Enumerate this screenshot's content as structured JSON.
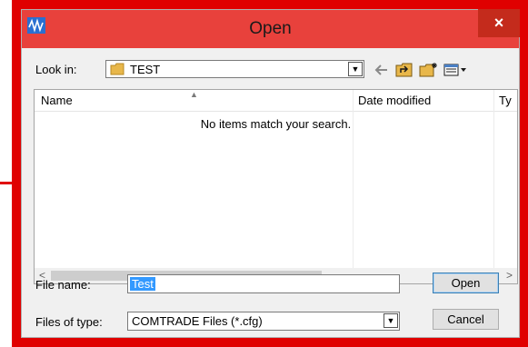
{
  "window": {
    "title": "Open",
    "close_glyph": "×",
    "accent": "#e00000",
    "title_bar_color": "#e8413c"
  },
  "lookin": {
    "label": "Look in:",
    "value": "TEST",
    "arrow": "▼"
  },
  "columns": {
    "name": "Name",
    "date_modified": "Date modified",
    "type": "Ty"
  },
  "list": {
    "empty_message": "No items match your search.",
    "scroll_left": "<",
    "scroll_right": ">"
  },
  "filename": {
    "label": "File name:",
    "value": "Test"
  },
  "filetype": {
    "label": "Files of type:",
    "value": "COMTRADE Files (*.cfg)",
    "arrow": "▼"
  },
  "buttons": {
    "open": "Open",
    "cancel": "Cancel"
  },
  "icons": [
    "app-waveform-icon",
    "folder-icon",
    "back-arrow-icon",
    "up-folder-icon",
    "new-folder-icon",
    "view-menu-icon"
  ]
}
